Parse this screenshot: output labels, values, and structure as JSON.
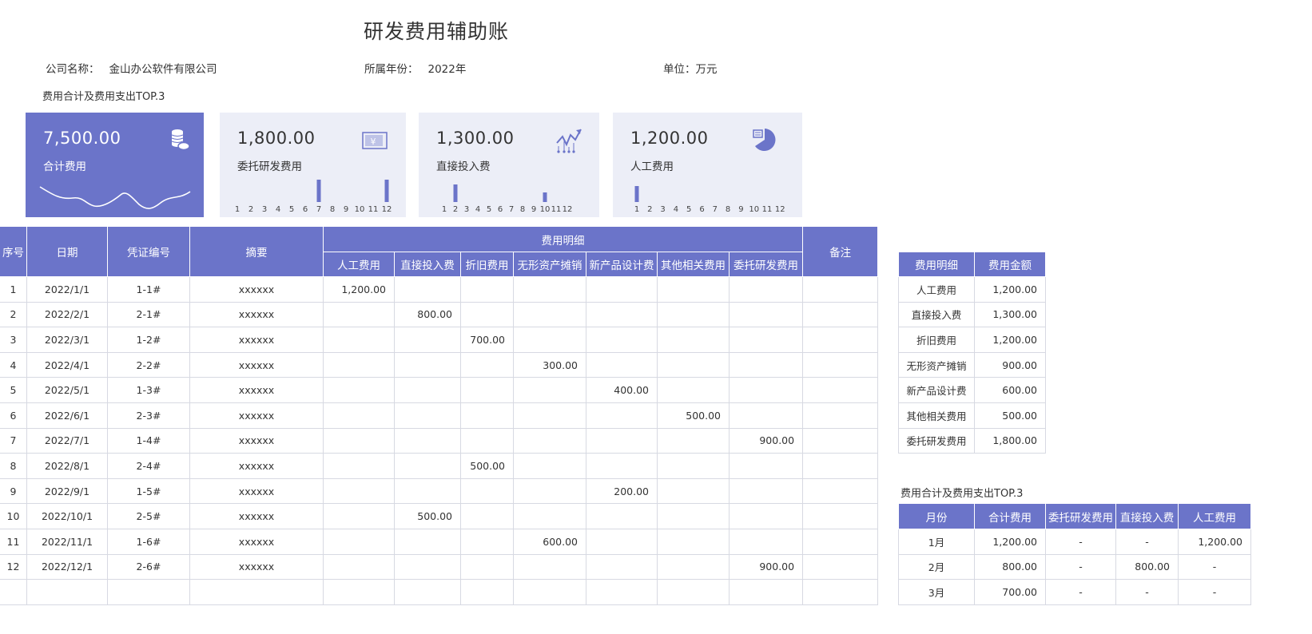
{
  "page": {
    "title": "研发费用辅助账",
    "company_label": "公司名称：",
    "company": "金山办公软件有限公司",
    "year_label": "所属年份：",
    "year": "2022年",
    "unit": "单位：万元",
    "section_label": "费用合计及费用支出TOP.3"
  },
  "colors": {
    "accent": "#6b74c9",
    "card_bg": "#eceef7"
  },
  "cards": [
    {
      "amount": "7,500.00",
      "label": "合计费用",
      "icon": "coins-icon"
    },
    {
      "amount": "1,800.00",
      "label": "委托研发费用",
      "icon": "yuan-bill-icon",
      "bar_months": [
        7,
        12
      ]
    },
    {
      "amount": "1,300.00",
      "label": "直接投入费",
      "icon": "trend-chart-icon",
      "bar_months": [
        2,
        10
      ]
    },
    {
      "amount": "1,200.00",
      "label": "人工费用",
      "icon": "pie-report-icon",
      "bar_months": [
        1
      ]
    }
  ],
  "month_ticks": [
    "1",
    "2",
    "3",
    "4",
    "5",
    "6",
    "7",
    "8",
    "9",
    "10",
    "11",
    "12"
  ],
  "ledger": {
    "headers": {
      "seq": "序号",
      "date": "日期",
      "voucher": "凭证编号",
      "summary": "摘要",
      "detail_group": "费用明细",
      "remark": "备注",
      "detail": [
        "人工费用",
        "直接投入费",
        "折旧费用",
        "无形资产摊销",
        "新产品设计费",
        "其他相关费用",
        "委托研发费用"
      ]
    },
    "rows": [
      {
        "seq": "1",
        "date": "2022/1/1",
        "voucher": "1-1#",
        "summary": "xxxxxx",
        "col": 0,
        "amount": "1,200.00"
      },
      {
        "seq": "2",
        "date": "2022/2/1",
        "voucher": "2-1#",
        "summary": "xxxxxx",
        "col": 1,
        "amount": "800.00"
      },
      {
        "seq": "3",
        "date": "2022/3/1",
        "voucher": "1-2#",
        "summary": "xxxxxx",
        "col": 2,
        "amount": "700.00"
      },
      {
        "seq": "4",
        "date": "2022/4/1",
        "voucher": "2-2#",
        "summary": "xxxxxx",
        "col": 3,
        "amount": "300.00"
      },
      {
        "seq": "5",
        "date": "2022/5/1",
        "voucher": "1-3#",
        "summary": "xxxxxx",
        "col": 4,
        "amount": "400.00"
      },
      {
        "seq": "6",
        "date": "2022/6/1",
        "voucher": "2-3#",
        "summary": "xxxxxx",
        "col": 5,
        "amount": "500.00"
      },
      {
        "seq": "7",
        "date": "2022/7/1",
        "voucher": "1-4#",
        "summary": "xxxxxx",
        "col": 6,
        "amount": "900.00"
      },
      {
        "seq": "8",
        "date": "2022/8/1",
        "voucher": "2-4#",
        "summary": "xxxxxx",
        "col": 2,
        "amount": "500.00"
      },
      {
        "seq": "9",
        "date": "2022/9/1",
        "voucher": "1-5#",
        "summary": "xxxxxx",
        "col": 4,
        "amount": "200.00"
      },
      {
        "seq": "10",
        "date": "2022/10/1",
        "voucher": "2-5#",
        "summary": "xxxxxx",
        "col": 1,
        "amount": "500.00"
      },
      {
        "seq": "11",
        "date": "2022/11/1",
        "voucher": "1-6#",
        "summary": "xxxxxx",
        "col": 3,
        "amount": "600.00"
      },
      {
        "seq": "12",
        "date": "2022/12/1",
        "voucher": "2-6#",
        "summary": "xxxxxx",
        "col": 6,
        "amount": "900.00"
      }
    ]
  },
  "summary_table": {
    "headers": [
      "费用明细",
      "费用金额"
    ],
    "rows": [
      [
        "人工费用",
        "1,200.00"
      ],
      [
        "直接投入费",
        "1,300.00"
      ],
      [
        "折旧费用",
        "1,200.00"
      ],
      [
        "无形资产摊销",
        "900.00"
      ],
      [
        "新产品设计费",
        "600.00"
      ],
      [
        "其他相关费用",
        "500.00"
      ],
      [
        "委托研发费用",
        "1,800.00"
      ]
    ]
  },
  "top3": {
    "label": "费用合计及费用支出TOP.3",
    "headers": [
      "月份",
      "合计费用",
      "委托研发费用",
      "直接投入费",
      "人工费用"
    ],
    "rows": [
      [
        "1月",
        "1,200.00",
        "-",
        "-",
        "1,200.00"
      ],
      [
        "2月",
        "800.00",
        "-",
        "800.00",
        "-"
      ],
      [
        "3月",
        "700.00",
        "-",
        "-",
        "-"
      ]
    ]
  }
}
